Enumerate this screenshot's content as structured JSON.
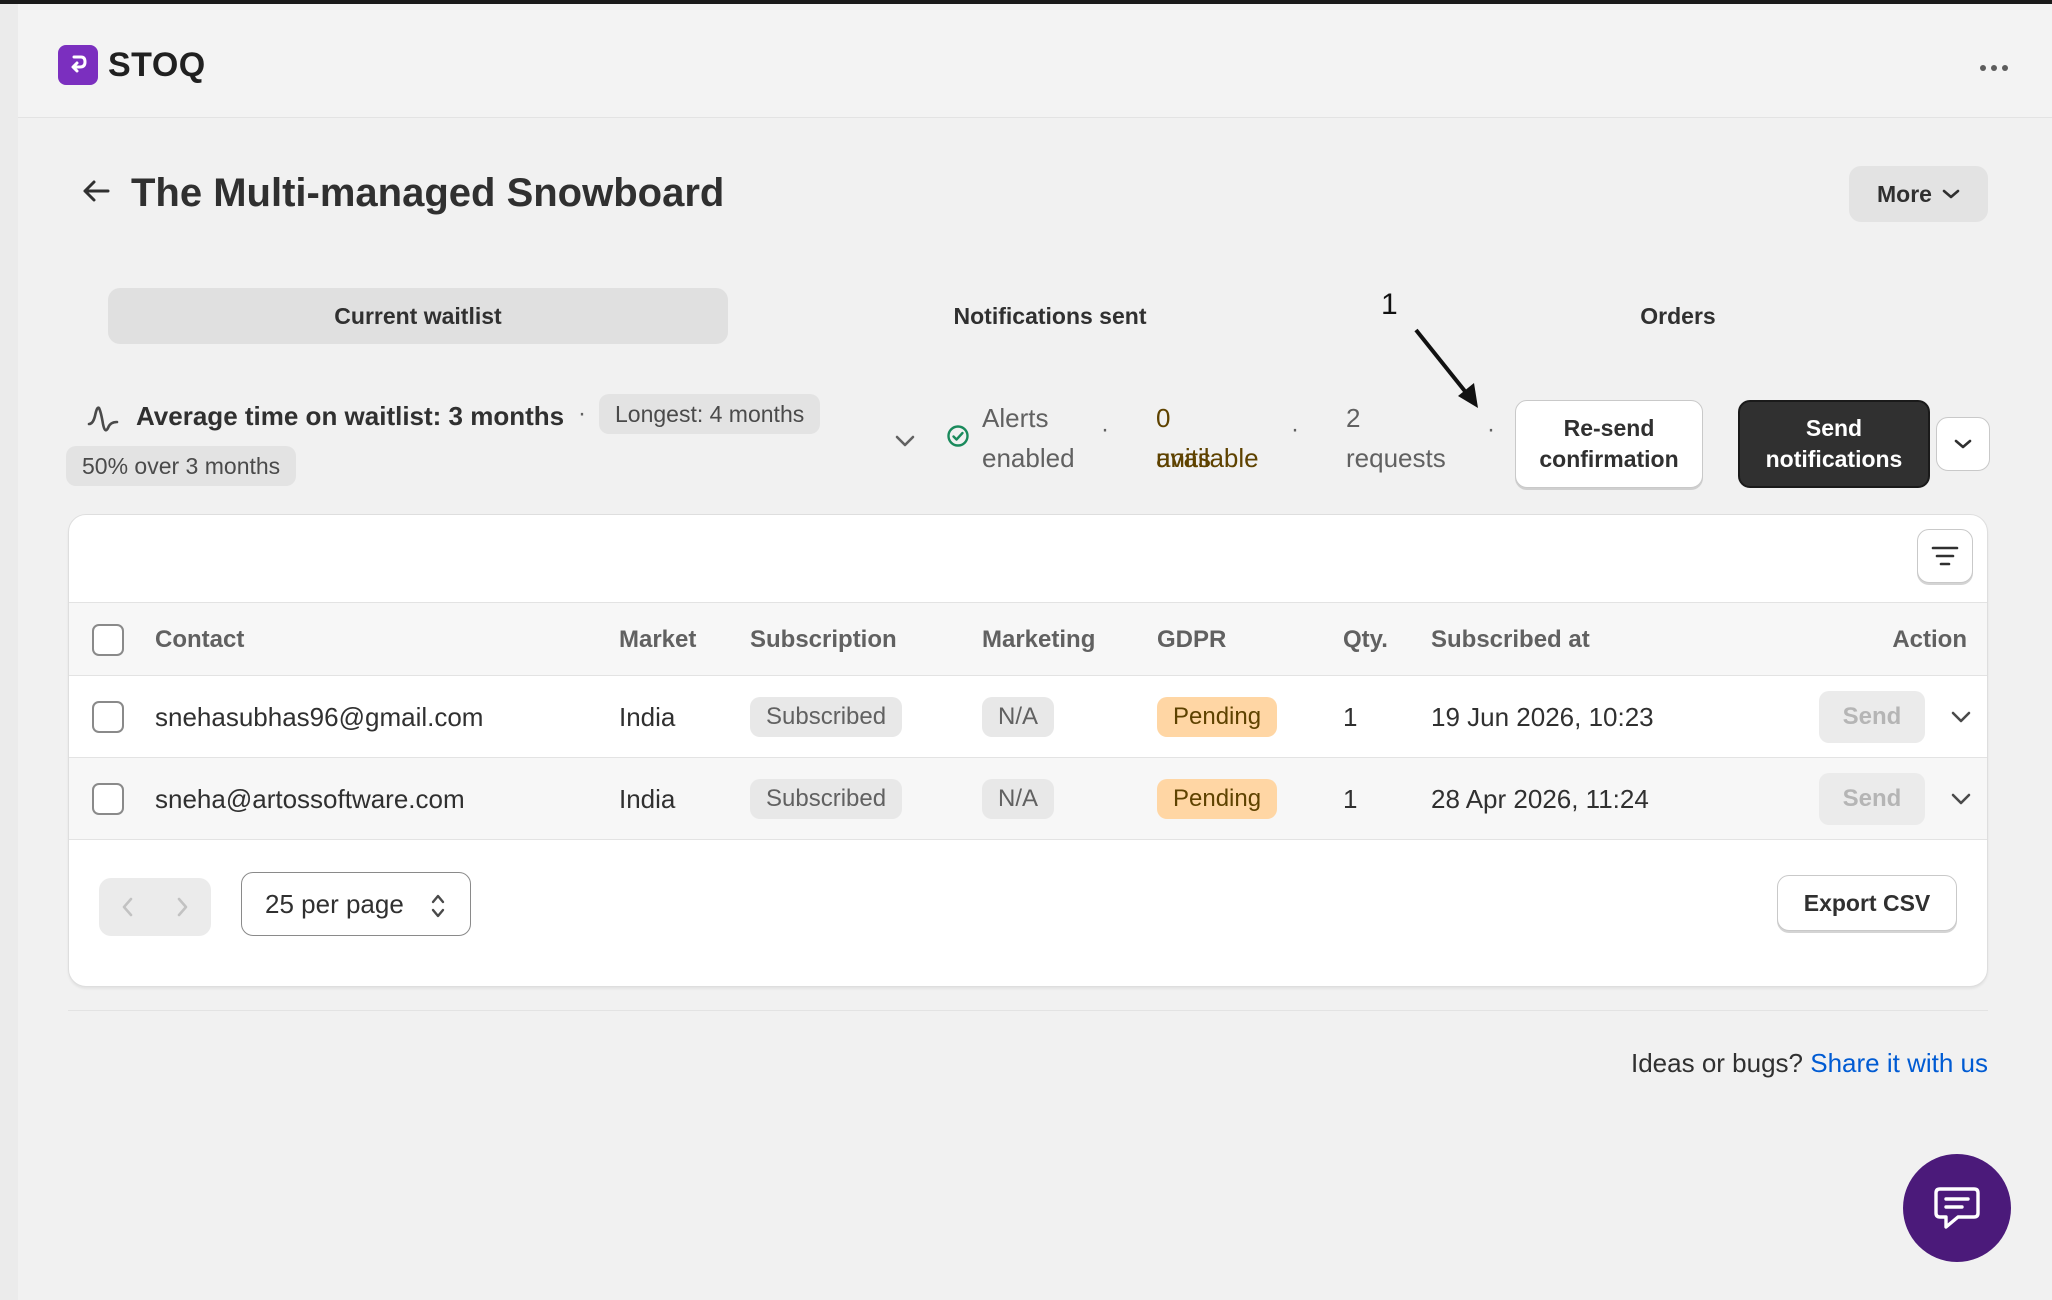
{
  "app": {
    "name": "STOQ"
  },
  "header": {
    "title": "The Multi-managed Snowboard",
    "more_label": "More"
  },
  "tabs": [
    {
      "label": "Current waitlist",
      "active": true
    },
    {
      "label": "Notifications sent",
      "active": false
    },
    {
      "label": "Orders",
      "active": false
    }
  ],
  "annotation": {
    "number": "1"
  },
  "stats": {
    "average": "Average time on waitlist: 3 months",
    "separator": "·",
    "longest": "Longest: 4 months",
    "over": "50% over 3 months",
    "alerts_line1": "Alerts",
    "alerts_line2": "enabled",
    "units_line1": "0 units",
    "units_line2": "available",
    "requests_line1": "2",
    "requests_line2": "requests"
  },
  "actions": {
    "resend_line1": "Re-send",
    "resend_line2": "confirmation",
    "send_line1": "Send",
    "send_line2": "notifications"
  },
  "table": {
    "columns": {
      "contact": "Contact",
      "market": "Market",
      "subscription": "Subscription",
      "marketing": "Marketing",
      "gdpr": "GDPR",
      "qty": "Qty.",
      "subscribed_at": "Subscribed at",
      "action": "Action"
    },
    "rows": [
      {
        "contact": "snehasubhas96@gmail.com",
        "market": "India",
        "subscription": "Subscribed",
        "marketing": "N/A",
        "gdpr": "Pending",
        "qty": "1",
        "subscribed_at": "19 Jun 2026, 10:23",
        "action": "Send"
      },
      {
        "contact": "sneha@artossoftware.com",
        "market": "India",
        "subscription": "Subscribed",
        "marketing": "N/A",
        "gdpr": "Pending",
        "qty": "1",
        "subscribed_at": "28 Apr 2026, 11:24",
        "action": "Send"
      }
    ]
  },
  "pagination": {
    "per_page": "25 per page"
  },
  "export": {
    "label": "Export CSV"
  },
  "footer": {
    "text": "Ideas or bugs?",
    "link": "Share it with us"
  },
  "colors": {
    "brand": "#7b2fbf",
    "primary_button": "#303030",
    "link": "#005bd3",
    "pending_badge": "#ffd6a4",
    "chat": "#4b1a7a",
    "success": "#1a8a5c"
  },
  "icons": [
    "dots-icon",
    "back-arrow-icon",
    "chevron-down-icon",
    "activity-icon",
    "check-circle-icon",
    "filter-icon",
    "chevron-left-icon",
    "chevron-right-icon",
    "select-arrows-icon",
    "chat-icon"
  ]
}
